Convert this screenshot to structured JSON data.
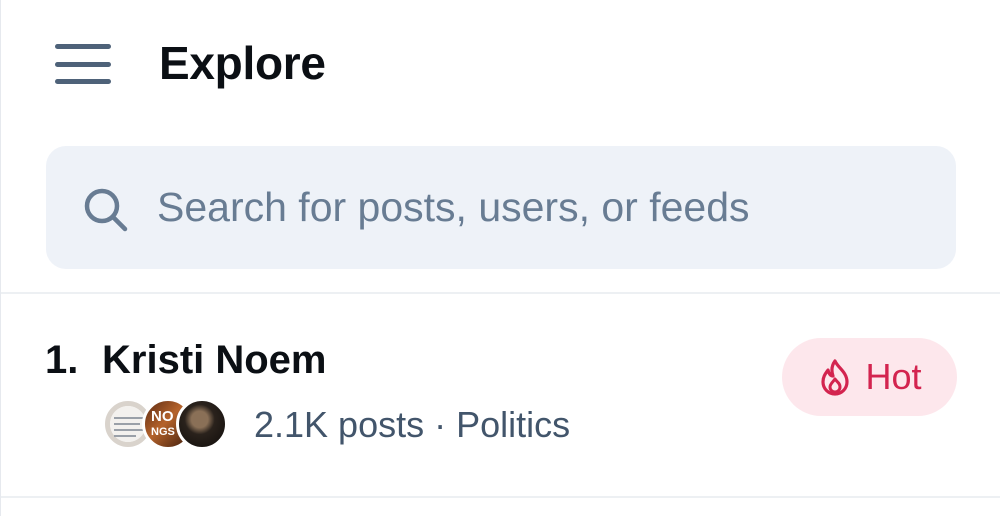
{
  "header": {
    "menu_icon": "hamburger-menu-icon",
    "title": "Explore"
  },
  "search": {
    "icon": "search-icon",
    "placeholder": "Search for posts, users, or feeds",
    "value": ""
  },
  "trending": [
    {
      "rank": "1.",
      "name": "Kristi Noem",
      "avatar_texts": [
        "NO",
        "NGS"
      ],
      "meta": "2.1K posts · Politics",
      "badge": {
        "label": "Hot",
        "icon": "flame-icon",
        "color": "#d3244f",
        "background": "#fde7ec"
      }
    }
  ],
  "colors": {
    "text_primary": "#0b0f14",
    "text_secondary": "#42556b",
    "placeholder": "#687c93",
    "search_bg": "#eef2f8",
    "icon": "#4e6279"
  }
}
